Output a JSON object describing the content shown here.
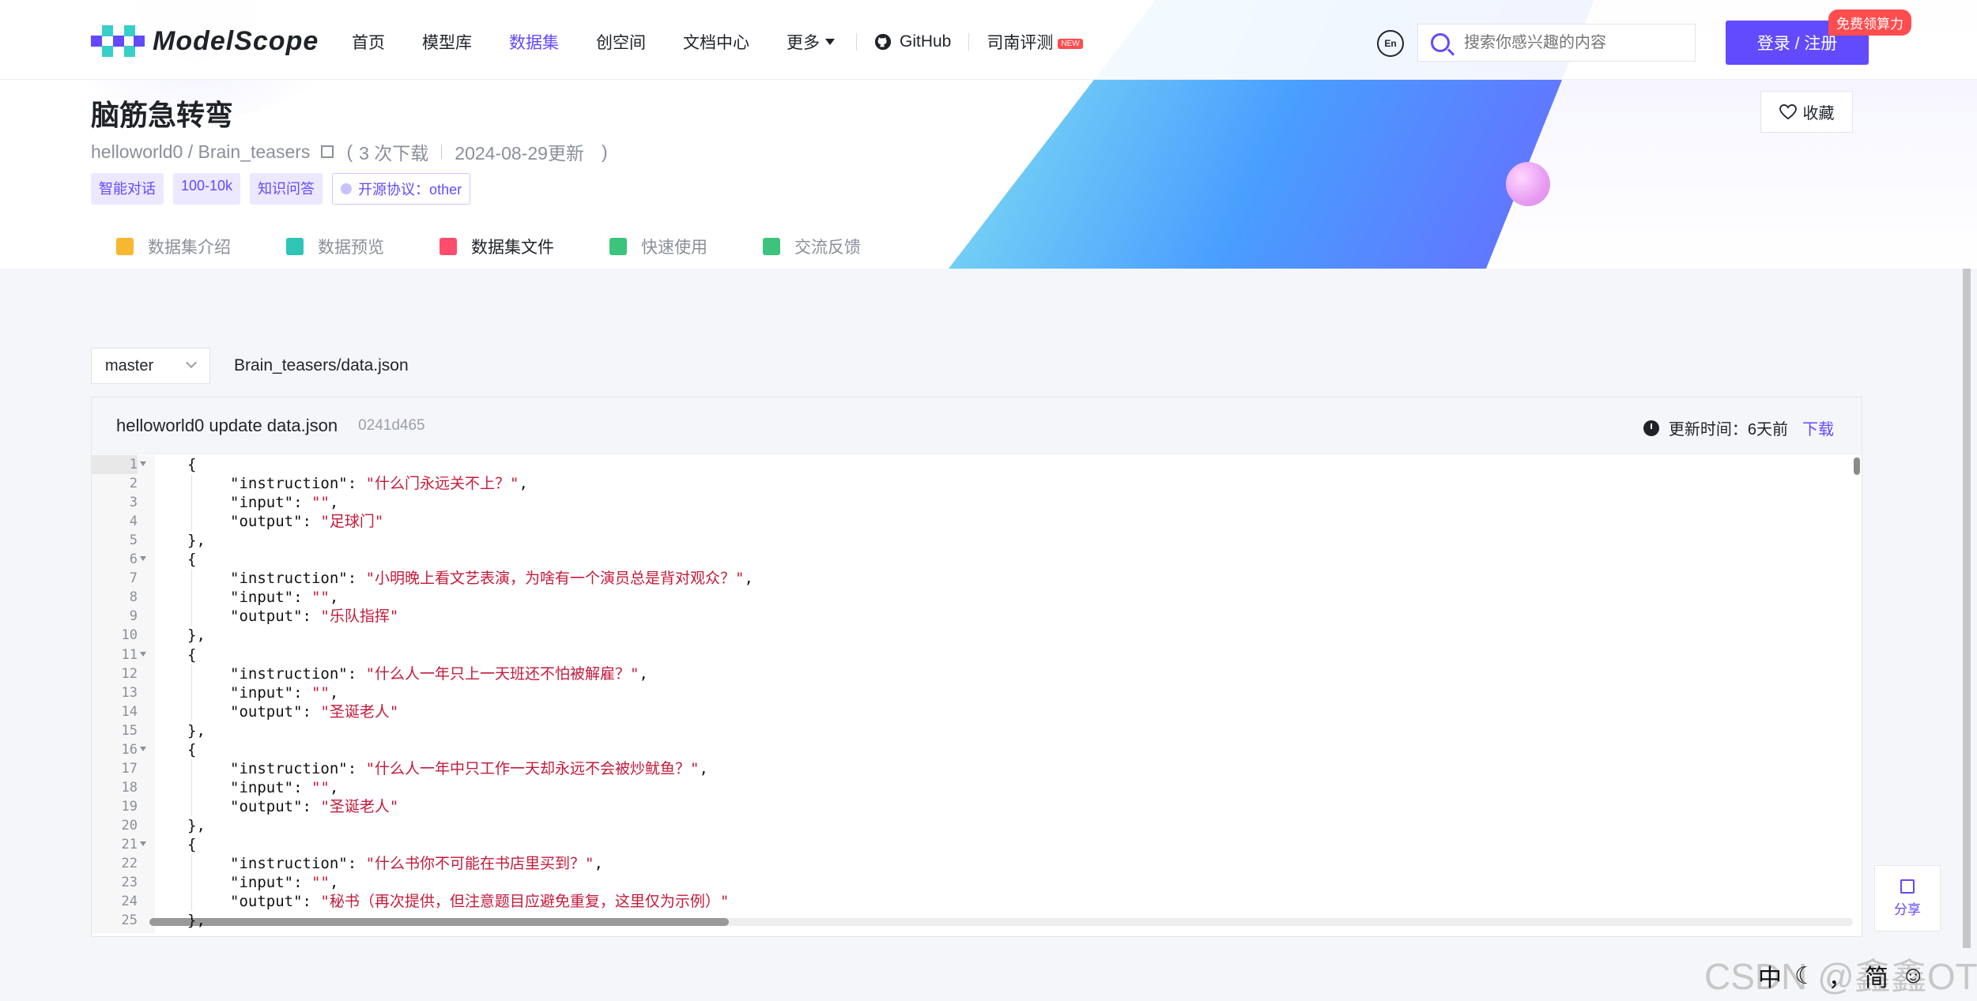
{
  "header": {
    "brand": "ModelScope",
    "nav": [
      {
        "label": "首页",
        "active": false
      },
      {
        "label": "模型库",
        "active": false
      },
      {
        "label": "数据集",
        "active": true
      },
      {
        "label": "创空间",
        "active": false
      },
      {
        "label": "文档中心",
        "active": false
      },
      {
        "label": "更多",
        "active": false
      }
    ],
    "github_label": "GitHub",
    "review_label": "司南评测",
    "review_badge": "NEW",
    "lang_icon_text": "En",
    "search_placeholder": "搜索你感兴趣的内容",
    "login_label": "登录 / 注册",
    "promo_badge": "免费领算力",
    "accent_color": "#624aff"
  },
  "dataset": {
    "title": "脑筋急转弯",
    "path": "helloworld0 / Brain_teasers",
    "downloads": "3 次下载",
    "updated": "2024-08-29更新",
    "paren_open": "(",
    "paren_close": ")",
    "tags": [
      "智能对话",
      "100-10k",
      "知识问答"
    ],
    "license": "开源协议：other",
    "favorite_label": "收藏"
  },
  "tabs": [
    {
      "label": "数据集介绍",
      "icon": "cube-icon",
      "active": false,
      "color": "#f7b731"
    },
    {
      "label": "数据预览",
      "icon": "preview-icon",
      "active": false,
      "color": "#2ec4b6"
    },
    {
      "label": "数据集文件",
      "icon": "book-icon",
      "active": true,
      "color": "#ff4d6d"
    },
    {
      "label": "快速使用",
      "icon": "paper-plane-icon",
      "active": false,
      "color": "#3cc47c"
    },
    {
      "label": "交流反馈",
      "icon": "edit-icon",
      "active": false,
      "color": "#3cc47c"
    }
  ],
  "file": {
    "branch": "master",
    "path": "Brain_teasers/data.json",
    "commit_message": "helloworld0 update data.json",
    "commit_hash": "0241d465",
    "updated_label": "更新时间：6天前",
    "download_label": "下载"
  },
  "code_lines": [
    {
      "n": "1",
      "fold": true,
      "indent": 0,
      "key": "",
      "val": "",
      "text": "{"
    },
    {
      "n": "2",
      "fold": false,
      "indent": 1,
      "key": "\"instruction\": ",
      "val": "\"什么门永远关不上？\"",
      "tail": ","
    },
    {
      "n": "3",
      "fold": false,
      "indent": 1,
      "key": "\"input\": ",
      "val": "\"\"",
      "tail": ","
    },
    {
      "n": "4",
      "fold": false,
      "indent": 1,
      "key": "\"output\": ",
      "val": "\"足球门\"",
      "tail": ""
    },
    {
      "n": "5",
      "fold": false,
      "indent": 0,
      "key": "",
      "val": "",
      "text": "},"
    },
    {
      "n": "6",
      "fold": true,
      "indent": 0,
      "key": "",
      "val": "",
      "text": "{"
    },
    {
      "n": "7",
      "fold": false,
      "indent": 1,
      "key": "\"instruction\": ",
      "val": "\"小明晚上看文艺表演，为啥有一个演员总是背对观众？\"",
      "tail": ","
    },
    {
      "n": "8",
      "fold": false,
      "indent": 1,
      "key": "\"input\": ",
      "val": "\"\"",
      "tail": ","
    },
    {
      "n": "9",
      "fold": false,
      "indent": 1,
      "key": "\"output\": ",
      "val": "\"乐队指挥\"",
      "tail": ""
    },
    {
      "n": "10",
      "fold": false,
      "indent": 0,
      "key": "",
      "val": "",
      "text": "},"
    },
    {
      "n": "11",
      "fold": true,
      "indent": 0,
      "key": "",
      "val": "",
      "text": "{"
    },
    {
      "n": "12",
      "fold": false,
      "indent": 1,
      "key": "\"instruction\": ",
      "val": "\"什么人一年只上一天班还不怕被解雇？\"",
      "tail": ","
    },
    {
      "n": "13",
      "fold": false,
      "indent": 1,
      "key": "\"input\": ",
      "val": "\"\"",
      "tail": ","
    },
    {
      "n": "14",
      "fold": false,
      "indent": 1,
      "key": "\"output\": ",
      "val": "\"圣诞老人\"",
      "tail": ""
    },
    {
      "n": "15",
      "fold": false,
      "indent": 0,
      "key": "",
      "val": "",
      "text": "},"
    },
    {
      "n": "16",
      "fold": true,
      "indent": 0,
      "key": "",
      "val": "",
      "text": "{"
    },
    {
      "n": "17",
      "fold": false,
      "indent": 1,
      "key": "\"instruction\": ",
      "val": "\"什么人一年中只工作一天却永远不会被炒鱿鱼？\"",
      "tail": ","
    },
    {
      "n": "18",
      "fold": false,
      "indent": 1,
      "key": "\"input\": ",
      "val": "\"\"",
      "tail": ","
    },
    {
      "n": "19",
      "fold": false,
      "indent": 1,
      "key": "\"output\": ",
      "val": "\"圣诞老人\"",
      "tail": ""
    },
    {
      "n": "20",
      "fold": false,
      "indent": 0,
      "key": "",
      "val": "",
      "text": "},"
    },
    {
      "n": "21",
      "fold": true,
      "indent": 0,
      "key": "",
      "val": "",
      "text": "{"
    },
    {
      "n": "22",
      "fold": false,
      "indent": 1,
      "key": "\"instruction\": ",
      "val": "\"什么书你不可能在书店里买到？\"",
      "tail": ","
    },
    {
      "n": "23",
      "fold": false,
      "indent": 1,
      "key": "\"input\": ",
      "val": "\"\"",
      "tail": ","
    },
    {
      "n": "24",
      "fold": false,
      "indent": 1,
      "key": "\"output\": ",
      "val": "\"秘书（再次提供，但注意题目应避免重复，这里仅为示例）\"",
      "tail": ""
    },
    {
      "n": "25",
      "fold": false,
      "indent": 0,
      "key": "",
      "val": "",
      "text": "},"
    }
  ],
  "share_label": "分享",
  "ime": [
    "中",
    "☾",
    "，",
    "简",
    "☺"
  ],
  "watermark": "CSDN @鑫鑫OT"
}
